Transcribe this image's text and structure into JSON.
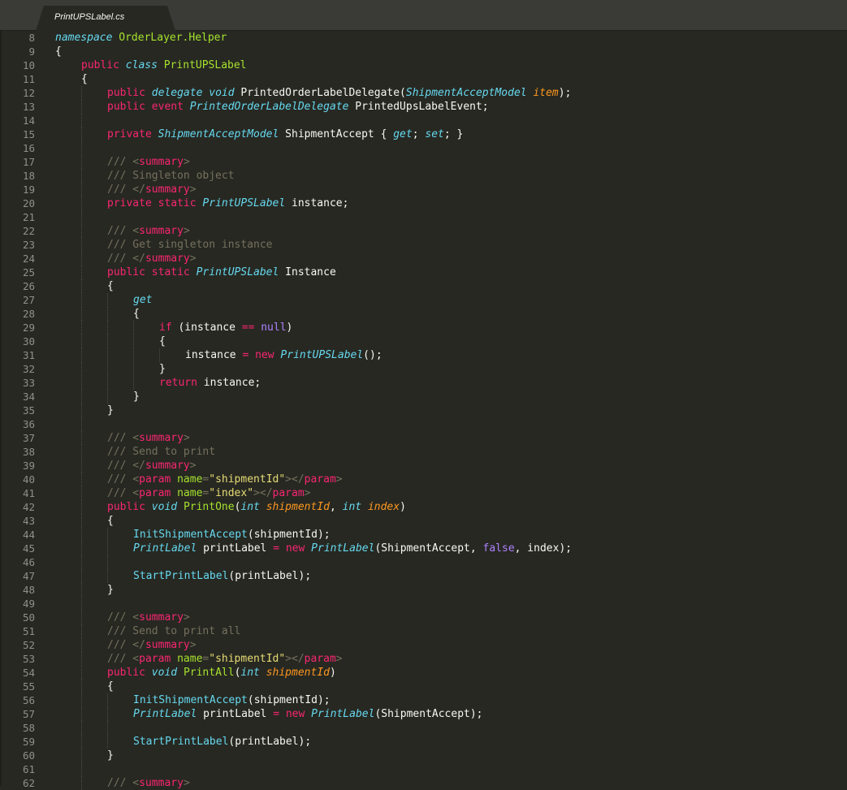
{
  "tab": {
    "filename": "PrintUPSLabel.cs"
  },
  "colors": {
    "background": "#272822",
    "plain": "#f8f8f2",
    "keyword": "#f92672",
    "storage": "#66d9ef",
    "function": "#a6e22e",
    "parameter": "#fd971f",
    "comment": "#75715e",
    "string": "#e6db74",
    "constant": "#ae81ff",
    "line_number": "#90908a"
  },
  "lines": [
    {
      "num": "8",
      "indent": 0,
      "tokens": [
        [
          "s",
          "namespace"
        ],
        [
          "p",
          " "
        ],
        [
          "f",
          "OrderLayer.Helper"
        ]
      ]
    },
    {
      "num": "9",
      "indent": 0,
      "tokens": [
        [
          "p",
          "{"
        ]
      ]
    },
    {
      "num": "10",
      "indent": 1,
      "tokens": [
        [
          "k",
          "public"
        ],
        [
          "p",
          " "
        ],
        [
          "s",
          "class"
        ],
        [
          "p",
          " "
        ],
        [
          "f",
          "PrintUPSLabel"
        ]
      ]
    },
    {
      "num": "11",
      "indent": 1,
      "tokens": [
        [
          "p",
          "{"
        ]
      ]
    },
    {
      "num": "12",
      "indent": 2,
      "tokens": [
        [
          "k",
          "public"
        ],
        [
          "p",
          " "
        ],
        [
          "s",
          "delegate"
        ],
        [
          "p",
          " "
        ],
        [
          "s",
          "void"
        ],
        [
          "p",
          " PrintedOrderLabelDelegate("
        ],
        [
          "s",
          "ShipmentAcceptModel"
        ],
        [
          "p",
          " "
        ],
        [
          "a",
          "item"
        ],
        [
          "p",
          ");"
        ]
      ]
    },
    {
      "num": "13",
      "indent": 2,
      "tokens": [
        [
          "k",
          "public"
        ],
        [
          "p",
          " "
        ],
        [
          "k",
          "event"
        ],
        [
          "p",
          " "
        ],
        [
          "s",
          "PrintedOrderLabelDelegate"
        ],
        [
          "p",
          " PrintedUpsLabelEvent;"
        ]
      ]
    },
    {
      "num": "14",
      "indent": 2,
      "tokens": []
    },
    {
      "num": "15",
      "indent": 2,
      "tokens": [
        [
          "k",
          "private"
        ],
        [
          "p",
          " "
        ],
        [
          "s",
          "ShipmentAcceptModel"
        ],
        [
          "p",
          " ShipmentAccept { "
        ],
        [
          "s",
          "get"
        ],
        [
          "p",
          "; "
        ],
        [
          "s",
          "set"
        ],
        [
          "p",
          "; }"
        ]
      ]
    },
    {
      "num": "16",
      "indent": 2,
      "tokens": []
    },
    {
      "num": "17",
      "indent": 2,
      "tokens": [
        [
          "c",
          "/// <"
        ],
        [
          "k",
          "summary"
        ],
        [
          "c",
          ">"
        ]
      ]
    },
    {
      "num": "18",
      "indent": 2,
      "tokens": [
        [
          "c",
          "/// Singleton object"
        ]
      ]
    },
    {
      "num": "19",
      "indent": 2,
      "tokens": [
        [
          "c",
          "/// </"
        ],
        [
          "k",
          "summary"
        ],
        [
          "c",
          ">"
        ]
      ]
    },
    {
      "num": "20",
      "indent": 2,
      "tokens": [
        [
          "k",
          "private"
        ],
        [
          "p",
          " "
        ],
        [
          "k",
          "static"
        ],
        [
          "p",
          " "
        ],
        [
          "s",
          "PrintUPSLabel"
        ],
        [
          "p",
          " instance;"
        ]
      ]
    },
    {
      "num": "21",
      "indent": 2,
      "tokens": []
    },
    {
      "num": "22",
      "indent": 2,
      "tokens": [
        [
          "c",
          "/// <"
        ],
        [
          "k",
          "summary"
        ],
        [
          "c",
          ">"
        ]
      ]
    },
    {
      "num": "23",
      "indent": 2,
      "tokens": [
        [
          "c",
          "/// Get singleton instance"
        ]
      ]
    },
    {
      "num": "24",
      "indent": 2,
      "tokens": [
        [
          "c",
          "/// </"
        ],
        [
          "k",
          "summary"
        ],
        [
          "c",
          ">"
        ]
      ]
    },
    {
      "num": "25",
      "indent": 2,
      "tokens": [
        [
          "k",
          "public"
        ],
        [
          "p",
          " "
        ],
        [
          "k",
          "static"
        ],
        [
          "p",
          " "
        ],
        [
          "s",
          "PrintUPSLabel"
        ],
        [
          "p",
          " Instance"
        ]
      ]
    },
    {
      "num": "26",
      "indent": 2,
      "tokens": [
        [
          "p",
          "{"
        ]
      ]
    },
    {
      "num": "27",
      "indent": 3,
      "tokens": [
        [
          "s",
          "get"
        ]
      ]
    },
    {
      "num": "28",
      "indent": 3,
      "tokens": [
        [
          "p",
          "{"
        ]
      ]
    },
    {
      "num": "29",
      "indent": 4,
      "tokens": [
        [
          "k",
          "if"
        ],
        [
          "p",
          " (instance "
        ],
        [
          "k",
          "=="
        ],
        [
          "p",
          " "
        ],
        [
          "v",
          "null"
        ],
        [
          "p",
          ")"
        ]
      ]
    },
    {
      "num": "30",
      "indent": 4,
      "tokens": [
        [
          "p",
          "{"
        ]
      ]
    },
    {
      "num": "31",
      "indent": 5,
      "tokens": [
        [
          "p",
          "instance "
        ],
        [
          "k",
          "="
        ],
        [
          "p",
          " "
        ],
        [
          "k",
          "new"
        ],
        [
          "p",
          " "
        ],
        [
          "s",
          "PrintUPSLabel"
        ],
        [
          "p",
          "();"
        ]
      ]
    },
    {
      "num": "32",
      "indent": 4,
      "tokens": [
        [
          "p",
          "}"
        ]
      ]
    },
    {
      "num": "33",
      "indent": 4,
      "tokens": [
        [
          "k",
          "return"
        ],
        [
          "p",
          " instance;"
        ]
      ]
    },
    {
      "num": "34",
      "indent": 3,
      "tokens": [
        [
          "p",
          "}"
        ]
      ]
    },
    {
      "num": "35",
      "indent": 2,
      "tokens": [
        [
          "p",
          "}"
        ]
      ]
    },
    {
      "num": "36",
      "indent": 2,
      "tokens": []
    },
    {
      "num": "37",
      "indent": 2,
      "tokens": [
        [
          "c",
          "/// <"
        ],
        [
          "k",
          "summary"
        ],
        [
          "c",
          ">"
        ]
      ]
    },
    {
      "num": "38",
      "indent": 2,
      "tokens": [
        [
          "c",
          "/// Send to print"
        ]
      ]
    },
    {
      "num": "39",
      "indent": 2,
      "tokens": [
        [
          "c",
          "/// </"
        ],
        [
          "k",
          "summary"
        ],
        [
          "c",
          ">"
        ]
      ]
    },
    {
      "num": "40",
      "indent": 2,
      "tokens": [
        [
          "c",
          "/// <"
        ],
        [
          "k",
          "param"
        ],
        [
          "c",
          " "
        ],
        [
          "f",
          "name"
        ],
        [
          "c",
          "="
        ],
        [
          "q",
          "\"shipmentId\""
        ],
        [
          "c",
          "></"
        ],
        [
          "k",
          "param"
        ],
        [
          "c",
          ">"
        ]
      ]
    },
    {
      "num": "41",
      "indent": 2,
      "tokens": [
        [
          "c",
          "/// <"
        ],
        [
          "k",
          "param"
        ],
        [
          "c",
          " "
        ],
        [
          "f",
          "name"
        ],
        [
          "c",
          "="
        ],
        [
          "q",
          "\"index\""
        ],
        [
          "c",
          "></"
        ],
        [
          "k",
          "param"
        ],
        [
          "c",
          ">"
        ]
      ]
    },
    {
      "num": "42",
      "indent": 2,
      "tokens": [
        [
          "k",
          "public"
        ],
        [
          "p",
          " "
        ],
        [
          "s",
          "void"
        ],
        [
          "p",
          " "
        ],
        [
          "f",
          "PrintOne"
        ],
        [
          "p",
          "("
        ],
        [
          "s",
          "int"
        ],
        [
          "p",
          " "
        ],
        [
          "a",
          "shipmentId"
        ],
        [
          "p",
          ", "
        ],
        [
          "s",
          "int"
        ],
        [
          "p",
          " "
        ],
        [
          "a",
          "index"
        ],
        [
          "p",
          ")"
        ]
      ]
    },
    {
      "num": "43",
      "indent": 2,
      "tokens": [
        [
          "p",
          "{"
        ]
      ]
    },
    {
      "num": "44",
      "indent": 3,
      "tokens": [
        [
          "s2",
          "InitShipmentAccept"
        ],
        [
          "p",
          "(shipmentId);"
        ]
      ]
    },
    {
      "num": "45",
      "indent": 3,
      "tokens": [
        [
          "s",
          "PrintLabel"
        ],
        [
          "p",
          " printLabel "
        ],
        [
          "k",
          "="
        ],
        [
          "p",
          " "
        ],
        [
          "k",
          "new"
        ],
        [
          "p",
          " "
        ],
        [
          "s",
          "PrintLabel"
        ],
        [
          "p",
          "(ShipmentAccept, "
        ],
        [
          "v",
          "false"
        ],
        [
          "p",
          ", index);"
        ]
      ]
    },
    {
      "num": "46",
      "indent": 3,
      "tokens": []
    },
    {
      "num": "47",
      "indent": 3,
      "tokens": [
        [
          "s2",
          "StartPrintLabel"
        ],
        [
          "p",
          "(printLabel);"
        ]
      ]
    },
    {
      "num": "48",
      "indent": 2,
      "tokens": [
        [
          "p",
          "}"
        ]
      ]
    },
    {
      "num": "49",
      "indent": 2,
      "tokens": []
    },
    {
      "num": "50",
      "indent": 2,
      "tokens": [
        [
          "c",
          "/// <"
        ],
        [
          "k",
          "summary"
        ],
        [
          "c",
          ">"
        ]
      ]
    },
    {
      "num": "51",
      "indent": 2,
      "tokens": [
        [
          "c",
          "/// Send to print all"
        ]
      ]
    },
    {
      "num": "52",
      "indent": 2,
      "tokens": [
        [
          "c",
          "/// </"
        ],
        [
          "k",
          "summary"
        ],
        [
          "c",
          ">"
        ]
      ]
    },
    {
      "num": "53",
      "indent": 2,
      "tokens": [
        [
          "c",
          "/// <"
        ],
        [
          "k",
          "param"
        ],
        [
          "c",
          " "
        ],
        [
          "f",
          "name"
        ],
        [
          "c",
          "="
        ],
        [
          "q",
          "\"shipmentId\""
        ],
        [
          "c",
          "></"
        ],
        [
          "k",
          "param"
        ],
        [
          "c",
          ">"
        ]
      ]
    },
    {
      "num": "54",
      "indent": 2,
      "tokens": [
        [
          "k",
          "public"
        ],
        [
          "p",
          " "
        ],
        [
          "s",
          "void"
        ],
        [
          "p",
          " "
        ],
        [
          "f",
          "PrintAll"
        ],
        [
          "p",
          "("
        ],
        [
          "s",
          "int"
        ],
        [
          "p",
          " "
        ],
        [
          "a",
          "shipmentId"
        ],
        [
          "p",
          ")"
        ]
      ]
    },
    {
      "num": "55",
      "indent": 2,
      "tokens": [
        [
          "p",
          "{"
        ]
      ]
    },
    {
      "num": "56",
      "indent": 3,
      "tokens": [
        [
          "s2",
          "InitShipmentAccept"
        ],
        [
          "p",
          "(shipmentId);"
        ]
      ]
    },
    {
      "num": "57",
      "indent": 3,
      "tokens": [
        [
          "s",
          "PrintLabel"
        ],
        [
          "p",
          " printLabel "
        ],
        [
          "k",
          "="
        ],
        [
          "p",
          " "
        ],
        [
          "k",
          "new"
        ],
        [
          "p",
          " "
        ],
        [
          "s",
          "PrintLabel"
        ],
        [
          "p",
          "(ShipmentAccept);"
        ]
      ]
    },
    {
      "num": "58",
      "indent": 3,
      "tokens": []
    },
    {
      "num": "59",
      "indent": 3,
      "tokens": [
        [
          "s2",
          "StartPrintLabel"
        ],
        [
          "p",
          "(printLabel);"
        ]
      ]
    },
    {
      "num": "60",
      "indent": 2,
      "tokens": [
        [
          "p",
          "}"
        ]
      ]
    },
    {
      "num": "61",
      "indent": 2,
      "tokens": []
    },
    {
      "num": "62",
      "indent": 2,
      "tokens": [
        [
          "c",
          "/// <"
        ],
        [
          "k",
          "summary"
        ],
        [
          "c",
          ">"
        ]
      ]
    }
  ]
}
